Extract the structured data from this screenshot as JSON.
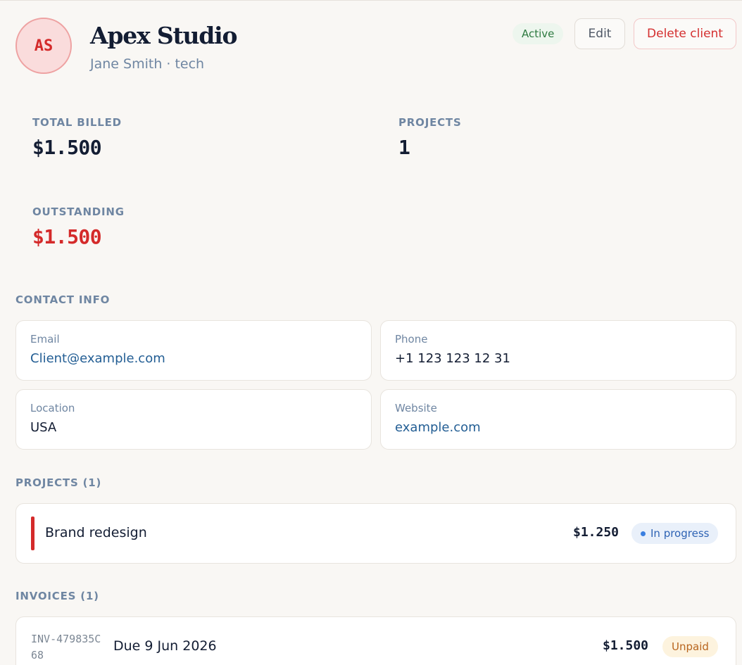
{
  "client": {
    "initials": "AS",
    "name": "Apex Studio",
    "subtitle": "Jane Smith · tech",
    "status": "Active"
  },
  "actions": {
    "edit_label": "Edit",
    "delete_label": "Delete client"
  },
  "stats": {
    "total_billed": {
      "label": "TOTAL BILLED",
      "value": "$1.500"
    },
    "projects": {
      "label": "PROJECTS",
      "value": "1"
    },
    "outstanding": {
      "label": "OUTSTANDING",
      "value": "$1.500"
    }
  },
  "contact": {
    "title": "CONTACT INFO",
    "email": {
      "label": "Email",
      "value": "Client@example.com"
    },
    "phone": {
      "label": "Phone",
      "value": "+1 123 123 12 31"
    },
    "location": {
      "label": "Location",
      "value": "USA"
    },
    "website": {
      "label": "Website",
      "value": "example.com"
    }
  },
  "projects": {
    "title": "PROJECTS (1)",
    "items": [
      {
        "name": "Brand redesign",
        "amount": "$1.250",
        "status": "In progress"
      }
    ]
  },
  "invoices": {
    "title": "INVOICES (1)",
    "items": [
      {
        "id": "INV-479835C68",
        "due": "Due 9 Jun 2026",
        "amount": "$1.500",
        "status": "Unpaid"
      }
    ]
  },
  "colors": {
    "accent_red": "#d42a2a",
    "link_blue": "#235e94",
    "active_green": "#2d7a40",
    "progress_blue": "#2e63b4",
    "unpaid_orange": "#b8651e"
  }
}
